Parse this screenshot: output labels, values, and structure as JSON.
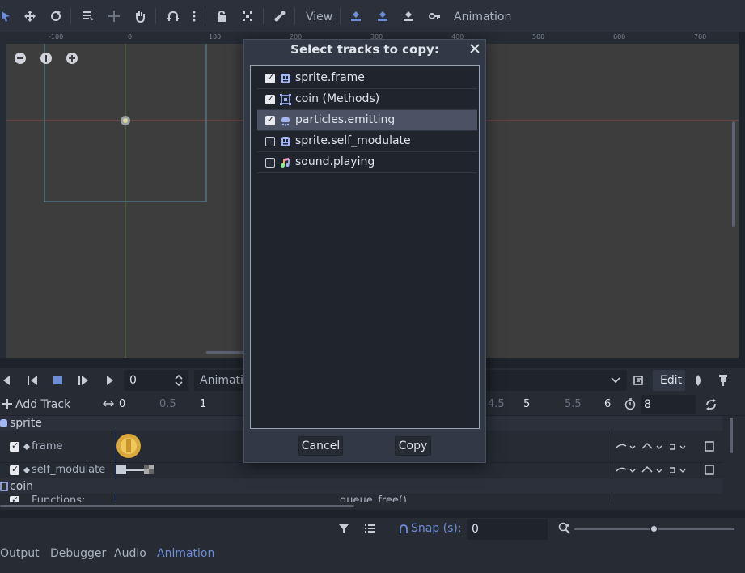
{
  "toolbar": {
    "view_label": "View",
    "animation_label": "Animation",
    "icons": [
      "select-arrow-icon",
      "move-icon",
      "rotate-icon",
      "list-select-icon",
      "pivot-icon",
      "pan-hand-icon",
      "snap-icon",
      "more-vertical-icon",
      "lock-icon",
      "group-icon",
      "bone-icon",
      "loc-key-icon",
      "rot-key-icon",
      "scl-key-icon",
      "key-icon"
    ]
  },
  "viewport": {
    "ruler_ticks": [
      "-100",
      "0",
      "100",
      "200",
      "300",
      "400",
      "500",
      "600",
      "700"
    ],
    "zoom_controls": [
      "zoom-out",
      "zoom-reset",
      "zoom-in"
    ]
  },
  "animation_panel": {
    "frame_value": "0",
    "animation_name": "Animati",
    "edit_label": "Edit",
    "add_track_label": "Add Track",
    "timeline_ticks": [
      "0",
      "0.5",
      "1",
      "4.5",
      "5",
      "5.5",
      "6"
    ],
    "length_value": "8",
    "tracks": [
      {
        "node": "sprite"
      },
      {
        "prop": "frame",
        "checked": true
      },
      {
        "prop": "self_modulate",
        "checked": true
      },
      {
        "node": "coin"
      },
      {
        "prop": "Functions:",
        "checked": true
      }
    ],
    "function_key": "queue_free()"
  },
  "bottom": {
    "snap_label": "Snap (s):",
    "snap_value": "0",
    "tabs": [
      "Output",
      "Debugger",
      "Audio",
      "Animation"
    ],
    "active_tab": "Animation"
  },
  "dialog": {
    "title": "Select tracks to copy:",
    "tracks": [
      {
        "label": "sprite.frame",
        "checked": true,
        "icon": "sprite-icon"
      },
      {
        "label": "coin (Methods)",
        "checked": true,
        "icon": "node-methods-icon"
      },
      {
        "label": "particles.emitting",
        "checked": true,
        "icon": "particles-icon",
        "selected": true
      },
      {
        "label": "sprite.self_modulate",
        "checked": false,
        "icon": "sprite-icon"
      },
      {
        "label": "sound.playing",
        "checked": false,
        "icon": "audio-icon"
      }
    ],
    "cancel_label": "Cancel",
    "copy_label": "Copy"
  },
  "colors": {
    "accent": "#6d8dd6",
    "dialog_bg": "#323845",
    "panel_bg": "#262b34"
  }
}
